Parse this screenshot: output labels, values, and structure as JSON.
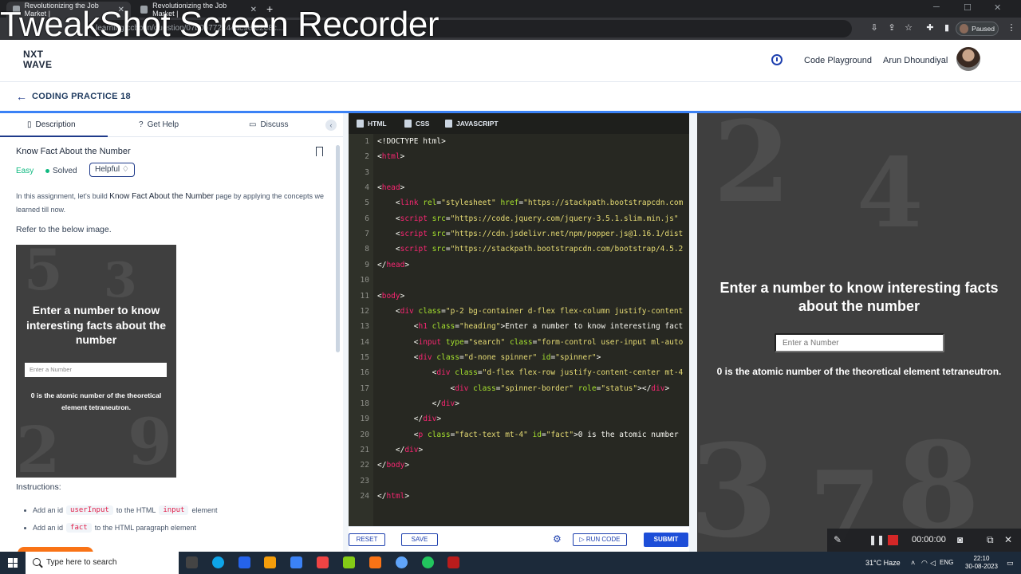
{
  "browser": {
    "tabs": [
      {
        "title": "Revolutionizing the Job Market |"
      },
      {
        "title": "Revolutionizing the Job Market |"
      }
    ],
    "url": "learning.ccbp.in/question/07b0b772244ac9e-e2e8c...",
    "profile_status": "Paused"
  },
  "watermark": "TweakShot Screen Recorder",
  "app": {
    "logo_line1": "NXT",
    "logo_line2": "WAVE",
    "code_playground": "Code Playground",
    "user_name": "Arun Dhoundiyal",
    "practice_title": "CODING PRACTICE 18"
  },
  "left_panel": {
    "tabs": [
      "Description",
      "Get Help",
      "Discuss"
    ],
    "problem_title": "Know Fact About the Number",
    "difficulty": "Easy",
    "status": "Solved",
    "helpful_label": "Helpful",
    "intro_prefix": "In this assignment, let's build ",
    "intro_highlight": "Know Fact About the Number",
    "intro_suffix": " page by applying the concepts we learned till now.",
    "refer": "Refer to the below image.",
    "preview": {
      "heading": "Enter a number to know interesting facts about the number",
      "input_placeholder": "Enter a Number",
      "fact": "0 is the atomic number of the theoretical element tetraneutron."
    },
    "instructions_heading": "Instructions:",
    "instructions": [
      {
        "prefix": "Add an id",
        "code": "userInput",
        "middle": "to the HTML",
        "code2": "input",
        "suffix": "element"
      },
      {
        "prefix": "Add an id",
        "code": "fact",
        "middle": "to the HTML paragraph element",
        "code2": "",
        "suffix": ""
      }
    ]
  },
  "editor": {
    "tabs": [
      "HTML",
      "CSS",
      "JAVASCRIPT"
    ],
    "line_numbers": [
      "1",
      "2",
      "3",
      "4",
      "5",
      "6",
      "7",
      "8",
      "9",
      "10",
      "11",
      "12",
      "13",
      "14",
      "15",
      "16",
      "17",
      "18",
      "19",
      "20",
      "21",
      "22",
      "23",
      "24"
    ],
    "buttons": {
      "reset": "RESET",
      "save": "SAVE",
      "run": "RUN CODE",
      "submit": "SUBMIT"
    }
  },
  "output": {
    "heading": "Enter a number to know interesting facts about the number",
    "input_placeholder": "Enter a Number",
    "fact": "0 is the atomic number of the theoretical element tetraneutron."
  },
  "recorder": {
    "time": "00:00:00"
  },
  "taskbar": {
    "search_placeholder": "Type here to search",
    "weather": "31°C Haze",
    "language": "ENG",
    "time": "22:10",
    "date": "30-08-2023"
  }
}
